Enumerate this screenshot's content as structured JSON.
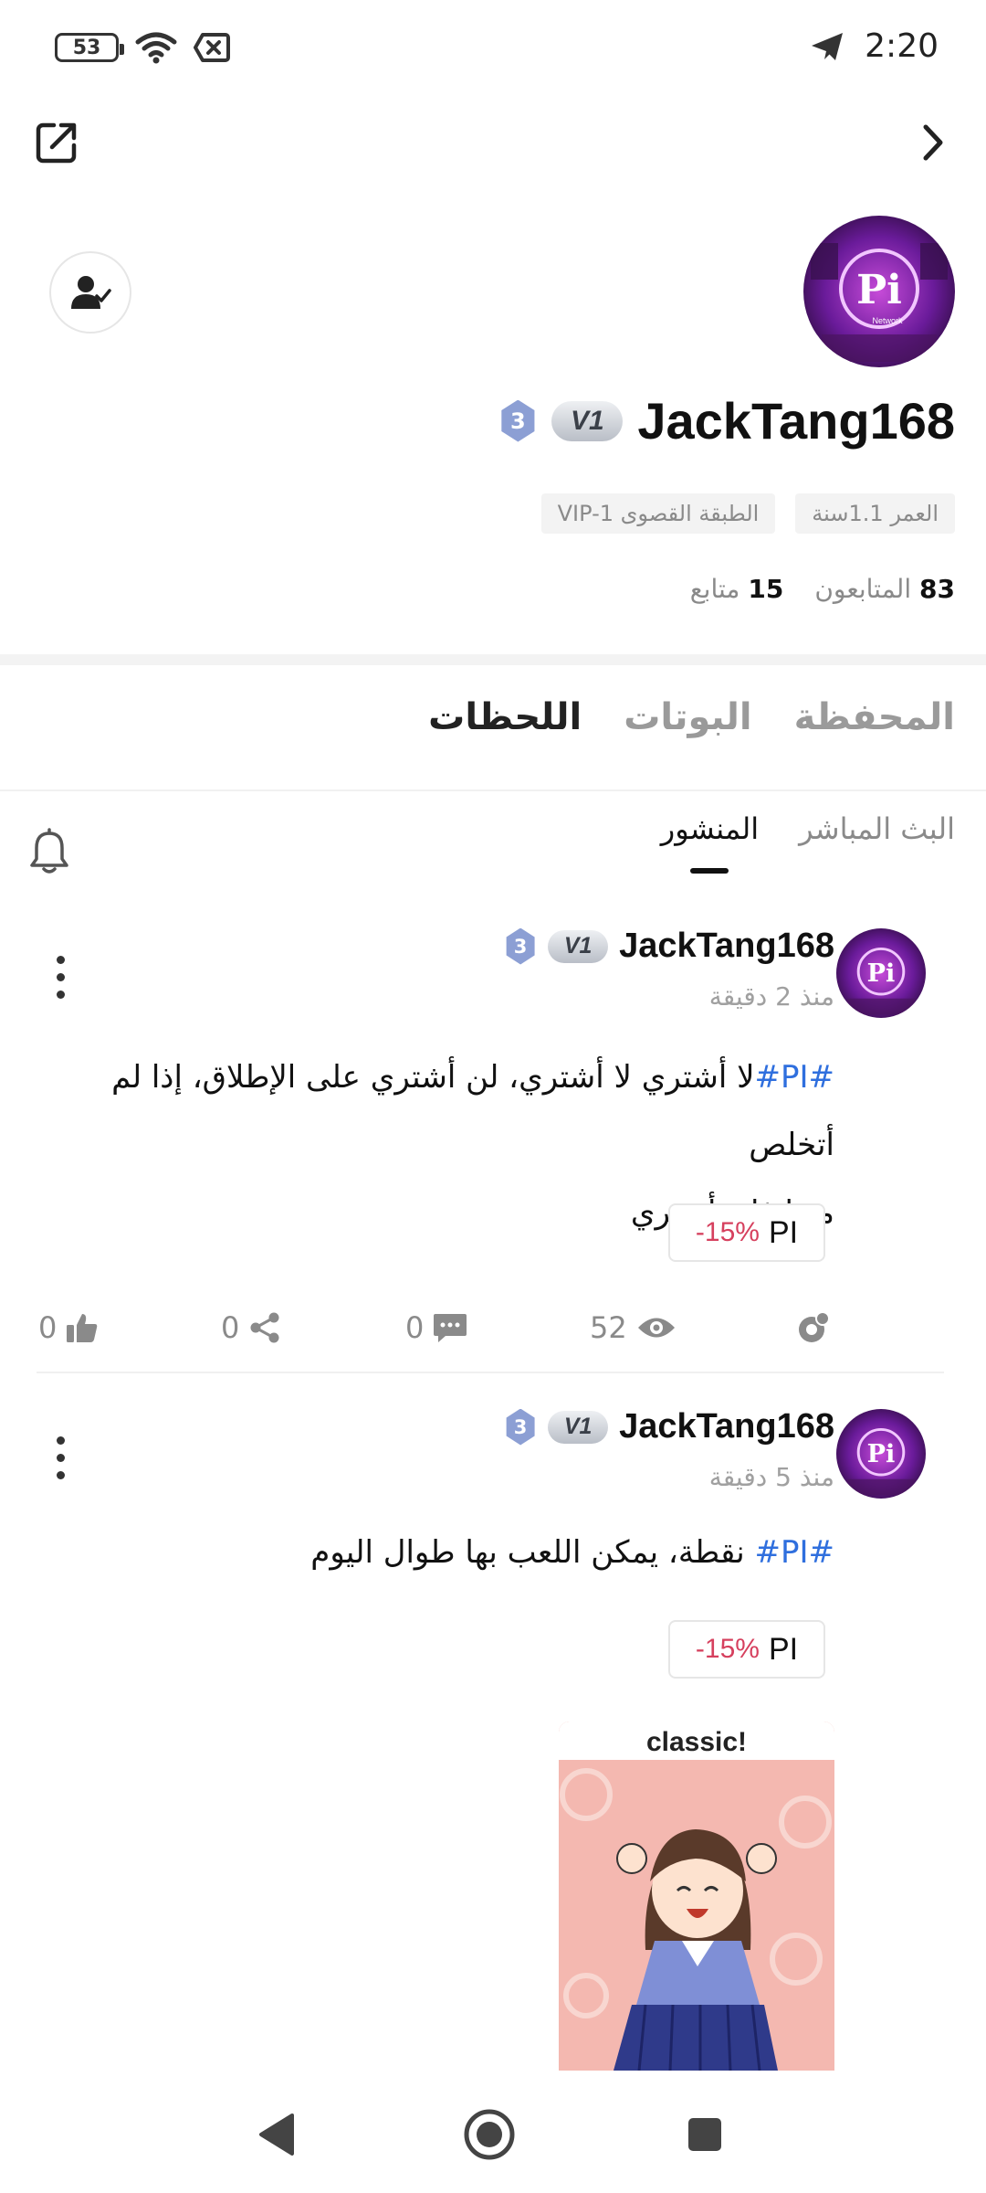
{
  "status_bar": {
    "battery": "53",
    "time": "2:20",
    "icons": [
      "battery-icon",
      "wifi-icon",
      "no-sim-icon",
      "telegram-icon"
    ]
  },
  "top_bar": {
    "icons": [
      "share-external-icon",
      "chevron-right-icon"
    ]
  },
  "profile": {
    "username": "JackTang168",
    "vip_badge": "V1",
    "level_badge": "3",
    "tags": [
      "العمر 1.1سنة",
      "الطبقة القصوى VIP-1"
    ],
    "following_count": "15",
    "following_label": "متابع",
    "followers_count": "83",
    "followers_label": "المتابعون"
  },
  "main_tabs": [
    "اللحظات",
    "البوتات",
    "المحفظة"
  ],
  "sub_tabs": [
    "المنشور",
    "البث المباشر"
  ],
  "posts": [
    {
      "username": "JackTang168",
      "vip_badge": "V1",
      "level_badge": "3",
      "time": "منذ 2 دقيقة",
      "hashtag": "#PI#",
      "text_line1": "لا أشتري لا أشتري، لن أشتري على الإطلاق، إذا لم أتخلص",
      "text_line2": "منها فلن أشتري",
      "coin": "PI",
      "change": "-15%",
      "views": "52",
      "comments": "0",
      "shares": "0",
      "likes": "0"
    },
    {
      "username": "JackTang168",
      "vip_badge": "V1",
      "level_badge": "3",
      "time": "منذ 5 دقيقة",
      "hashtag": "#PI#",
      "text_line1": "نقطة، يمكن اللعب بها طوال اليوم",
      "coin": "PI",
      "change": "-15%",
      "sticker_caption": "classic!"
    }
  ],
  "colors": {
    "hashtag": "#2f6fde",
    "negative": "#d6405e",
    "muted": "#8a8a8a",
    "avatar_purple": "#7b1fa2"
  }
}
